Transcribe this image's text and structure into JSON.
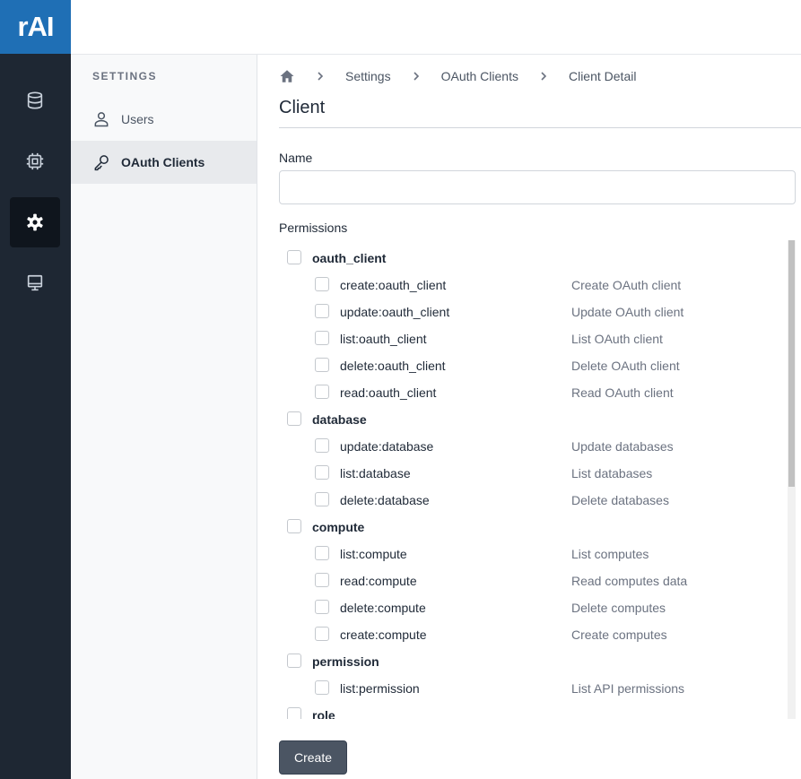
{
  "logo": {
    "text": "rAI"
  },
  "rail": {
    "items": [
      {
        "icon": "database-icon"
      },
      {
        "icon": "chip-icon"
      },
      {
        "icon": "gear-icon",
        "active": true
      },
      {
        "icon": "monitor-icon"
      }
    ]
  },
  "settings_nav": {
    "heading": "SETTINGS",
    "items": [
      {
        "label": "Users",
        "icon": "users-icon"
      },
      {
        "label": "OAuth Clients",
        "icon": "key-icon",
        "active": true
      }
    ]
  },
  "breadcrumb": {
    "items": [
      "Settings",
      "OAuth Clients",
      "Client Detail"
    ]
  },
  "page": {
    "title": "Client"
  },
  "form": {
    "name_label": "Name",
    "name_value": "",
    "permissions_label": "Permissions",
    "create_label": "Create"
  },
  "permissions": [
    {
      "kind": "group",
      "name": "oauth_client"
    },
    {
      "kind": "item",
      "name": "create:oauth_client",
      "desc": "Create OAuth client"
    },
    {
      "kind": "item",
      "name": "update:oauth_client",
      "desc": "Update OAuth client"
    },
    {
      "kind": "item",
      "name": "list:oauth_client",
      "desc": "List OAuth client"
    },
    {
      "kind": "item",
      "name": "delete:oauth_client",
      "desc": "Delete OAuth client"
    },
    {
      "kind": "item",
      "name": "read:oauth_client",
      "desc": "Read OAuth client"
    },
    {
      "kind": "group",
      "name": "database"
    },
    {
      "kind": "item",
      "name": "update:database",
      "desc": "Update databases"
    },
    {
      "kind": "item",
      "name": "list:database",
      "desc": "List databases"
    },
    {
      "kind": "item",
      "name": "delete:database",
      "desc": "Delete databases"
    },
    {
      "kind": "group",
      "name": "compute"
    },
    {
      "kind": "item",
      "name": "list:compute",
      "desc": "List computes"
    },
    {
      "kind": "item",
      "name": "read:compute",
      "desc": "Read computes data"
    },
    {
      "kind": "item",
      "name": "delete:compute",
      "desc": "Delete computes"
    },
    {
      "kind": "item",
      "name": "create:compute",
      "desc": "Create computes"
    },
    {
      "kind": "group",
      "name": "permission"
    },
    {
      "kind": "item",
      "name": "list:permission",
      "desc": "List API permissions"
    },
    {
      "kind": "group",
      "name": "role"
    }
  ]
}
